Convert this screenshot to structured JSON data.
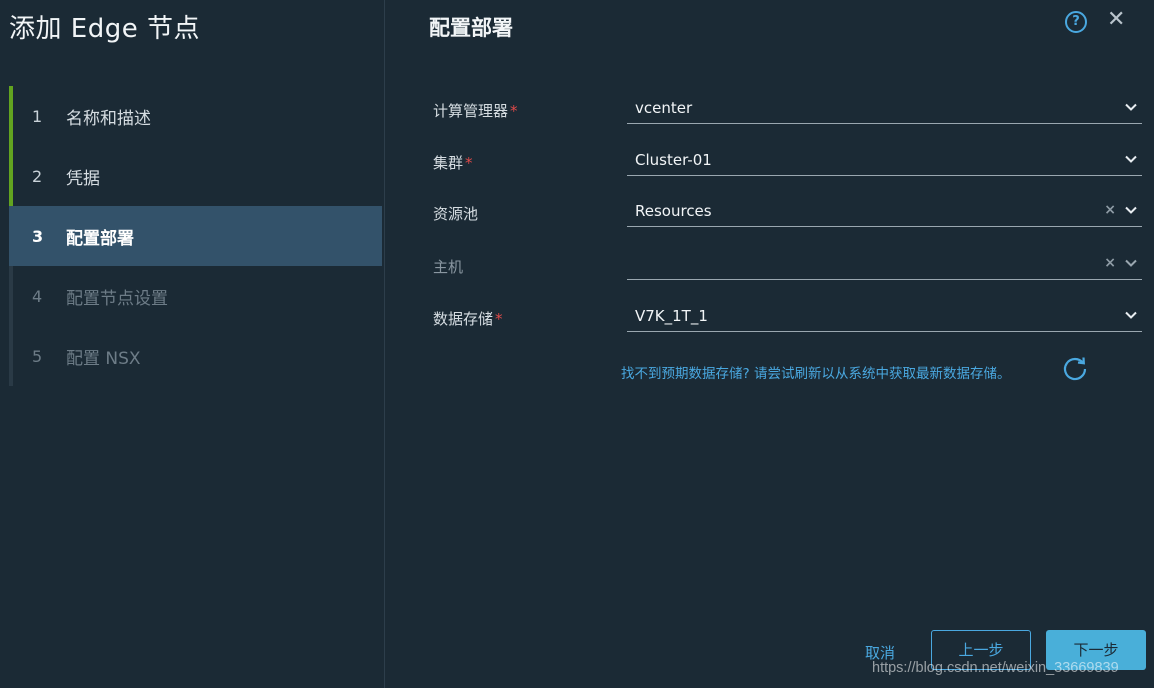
{
  "wizard": {
    "title": "添加 Edge 节点",
    "steps": [
      {
        "num": "1",
        "label": "名称和描述",
        "state": "done"
      },
      {
        "num": "2",
        "label": "凭据",
        "state": "done"
      },
      {
        "num": "3",
        "label": "配置部署",
        "state": "active"
      },
      {
        "num": "4",
        "label": "配置节点设置",
        "state": "disabled"
      },
      {
        "num": "5",
        "label": "配置 NSX",
        "state": "disabled"
      }
    ]
  },
  "page": {
    "title": "配置部署",
    "help_glyph": "?",
    "close_glyph": "✕"
  },
  "form": {
    "compute_manager": {
      "label": "计算管理器",
      "required_mark": "*",
      "value": "vcenter"
    },
    "cluster": {
      "label": "集群",
      "required_mark": "*",
      "value": "Cluster-01"
    },
    "resource_pool": {
      "label": "资源池",
      "value": "Resources",
      "clear_glyph": "×"
    },
    "host": {
      "label": "主机",
      "value": "",
      "clear_glyph": "×"
    },
    "datastore": {
      "label": "数据存储",
      "required_mark": "*",
      "value": "V7K_1T_1"
    }
  },
  "hint": {
    "text": "找不到预期数据存储? 请尝试刷新以从系统中获取最新数据存储。"
  },
  "footer": {
    "cancel": "取消",
    "previous": "上一步",
    "next": "下一步"
  },
  "watermark": "https://blog.csdn.net/weixin_33669839",
  "colors": {
    "background": "#1b2a35",
    "accent": "#4aa8e0",
    "done_bar": "#62a420",
    "active_step": "#33526a",
    "required": "#e04a4a"
  }
}
